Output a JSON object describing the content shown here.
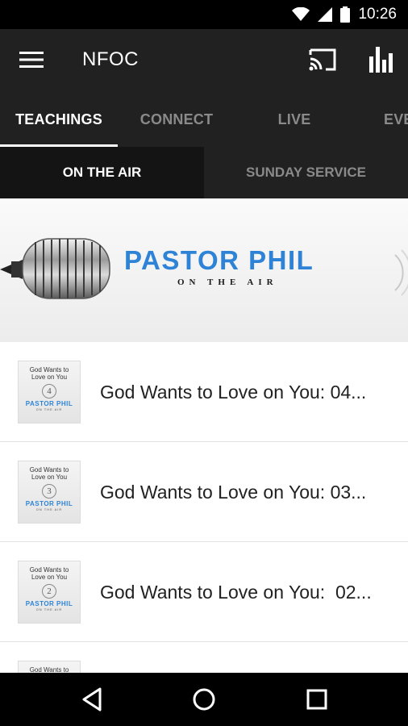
{
  "status_bar": {
    "time": "10:26",
    "icons": [
      "wifi-icon",
      "signal-icon",
      "battery-icon"
    ]
  },
  "app_bar": {
    "title": "NFOC",
    "icons": [
      "menu-icon",
      "cast-icon",
      "bar-chart-icon"
    ]
  },
  "tabs": [
    {
      "label": "TEACHINGS",
      "active": true
    },
    {
      "label": "CONNECT",
      "active": false
    },
    {
      "label": "LIVE",
      "active": false
    },
    {
      "label": "EVE",
      "active": false
    }
  ],
  "subtabs": [
    {
      "label": "ON THE AIR",
      "active": true
    },
    {
      "label": "SUNDAY SERVICE",
      "active": false
    }
  ],
  "banner": {
    "name": "PASTOR PHIL",
    "tagline": "ON THE AIR"
  },
  "items": [
    {
      "title": "God Wants to Love on You: 04...",
      "thumb": {
        "line1": "God Wants to",
        "line2": "Love on You",
        "number": "4",
        "brand": "PASTOR PHIL",
        "brand_sub": "ON THE AIR"
      }
    },
    {
      "title": "God Wants to Love on You: 03...",
      "thumb": {
        "line1": "God Wants to",
        "line2": "Love on You",
        "number": "3",
        "brand": "PASTOR PHIL",
        "brand_sub": "ON THE AIR"
      }
    },
    {
      "title": "God Wants to Love on You:  02...",
      "thumb": {
        "line1": "God Wants to",
        "line2": "Love on You",
        "number": "2",
        "brand": "PASTOR PHIL",
        "brand_sub": "ON THE AIR"
      }
    },
    {
      "title": "",
      "thumb": {
        "line1": "God Wants to",
        "line2": "",
        "number": "",
        "brand": "",
        "brand_sub": ""
      }
    }
  ],
  "nav_bar": {
    "icons": [
      "back-icon",
      "home-icon",
      "recents-icon"
    ]
  },
  "colors": {
    "app_bar": "#212121",
    "accent_blue": "#2e83d6",
    "inactive_text": "#8a8a8a"
  }
}
